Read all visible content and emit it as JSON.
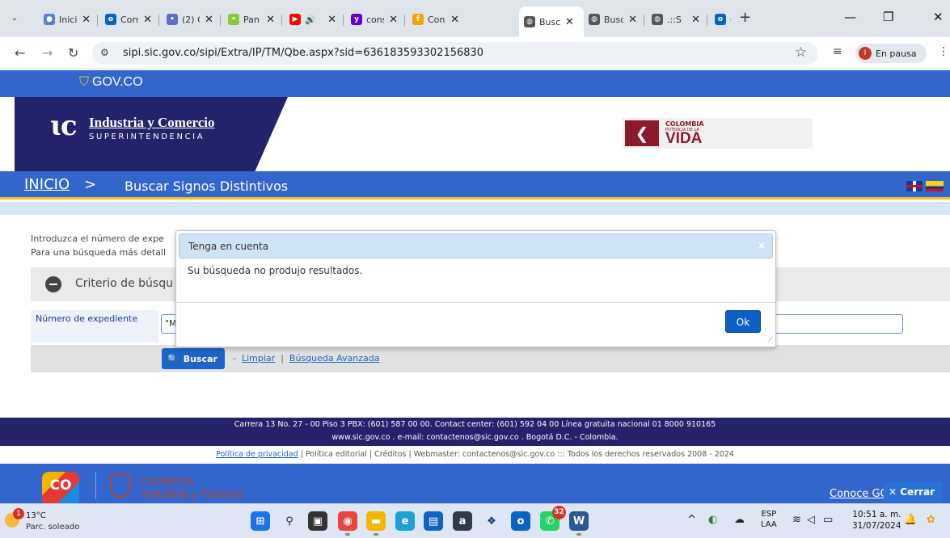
{
  "browser": {
    "tabs": [
      {
        "title": "Inici",
        "favicon": "#5b7fd6",
        "glyph": "●"
      },
      {
        "title": "Corr",
        "favicon": "#0a62c4",
        "glyph": "o"
      },
      {
        "title": "(2) C",
        "favicon": "#5a6fc2",
        "glyph": "•"
      },
      {
        "title": "Pan",
        "favicon": "#8cc63f",
        "glyph": "•"
      },
      {
        "title": "🔊",
        "favicon": "#ff0000",
        "glyph": "▶"
      },
      {
        "title": "cons",
        "favicon": "#6001d2",
        "glyph": "y"
      },
      {
        "title": "Con",
        "favicon": "#f0a500",
        "glyph": "f"
      },
      {
        "title": "Busc",
        "favicon": "#555555",
        "glyph": "◍"
      },
      {
        "title": "Busc",
        "favicon": "#555555",
        "glyph": "◍"
      },
      {
        "title": ".::S",
        "favicon": "#555555",
        "glyph": "◍"
      },
      {
        "title": "Corr",
        "favicon": "#0a62c4",
        "glyph": "o"
      }
    ],
    "active_tab": 7,
    "url": "sipi.sic.gov.co/sipi/Extra/IP/TM/Qbe.aspx?sid=636183593302156830",
    "profile_label": "En pausa",
    "profile_initial": "I"
  },
  "site": {
    "gov_logo": "GOV.CO",
    "org_name": "Industria y Comercio",
    "org_sub": "SUPERINTENDENCIA",
    "colombia_1": "COLOMBIA",
    "colombia_2": "POTENCIA DE LA",
    "colombia_3": "VIDA",
    "breadcrumb_home": "INICIO",
    "breadcrumb_sep": ">",
    "page_title": "Buscar Signos Distintivos",
    "intro_line1": "Introduzca el número de expe",
    "intro_line2": "Para una búsqueda más detall",
    "criterio_label": "Criterio de búsqu",
    "field_label": "Número de expediente",
    "field_value": "\"M",
    "buscar_label": "Buscar",
    "dash": "-",
    "limpiar_label": "Limpiar",
    "pipe": "|",
    "avanzada_label": "Búsqueda Avanzada",
    "footer_line1": "Carrera 13 No. 27 - 00 Piso 3 PBX: (601) 587 00 00. Contact center: (601) 592 04 00 Línea gratuita nacional 01 8000 910165",
    "footer_line2": "www.sic.gov.co . e-mail: contactenos@sic.gov.co . Bogotá D.C. - Colombia.",
    "footer_privacy": "Política de privacidad",
    "footer_rest": " | Política editorial | Créditos | Webmaster: contactenos@sic.gov.co ::: Todos los derechos reservados 2008 - 2024",
    "co_logo": "CO",
    "ministerio_1": "Comercio,",
    "ministerio_2": "Industria y Turismo",
    "conoce_label": "Conoce GC",
    "cerrar_label": "Cerrar"
  },
  "dialog": {
    "title": "Tenga en cuenta",
    "close_glyph": "×",
    "message": "Su búsqueda no produjo resultados.",
    "ok_label": "Ok"
  },
  "taskbar": {
    "temperature": "13°C",
    "condition": "Parc. soleado",
    "weather_badge": "1",
    "whatsapp_count": "32",
    "lang_1": "ESP",
    "lang_2": "LAA",
    "time": "10:51 a. m.",
    "date": "31/07/2024"
  }
}
